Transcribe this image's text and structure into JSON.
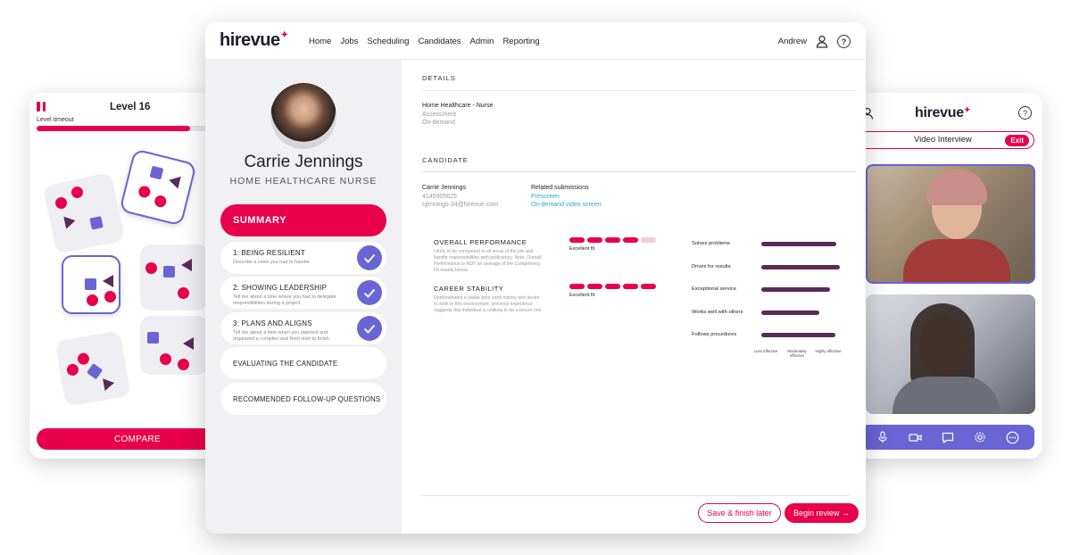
{
  "game": {
    "level": "Level 16",
    "timeout_label": "Level timeout",
    "timeout_progress": 0.78,
    "compare_button": "COMPARE"
  },
  "video": {
    "brand": "hirevue",
    "title": "Video Interview",
    "exit_label": "Exit",
    "help_symbol": "?",
    "toolbar_icons": [
      "microphone-icon",
      "camera-icon",
      "chat-icon",
      "settings-icon",
      "more-icon"
    ]
  },
  "main": {
    "brand": "hirevue",
    "nav": [
      "Home",
      "Jobs",
      "Scheduling",
      "Candidates",
      "Admin",
      "Reporting"
    ],
    "user": "Andrew",
    "help_symbol": "?",
    "candidate": {
      "name": "Carrie Jennings",
      "role": "HOME HEALTHCARE NURSE"
    },
    "summary_label": "SUMMARY",
    "competencies": [
      {
        "title": "1: BEING RESILIENT",
        "desc": "Describe a crisis you had to handle.",
        "done": true
      },
      {
        "title": "2: SHOWING LEADERSHIP",
        "desc": "Tell me about a time where you had to delegate responsibilities during a project.",
        "done": true
      },
      {
        "title": "3: PLANS AND ALIGNS",
        "desc": "Tell me about a time when you planned and organized a complex task from start to finish.",
        "done": true
      },
      {
        "title": "EVALUATING THE CANDIDATE",
        "desc": "",
        "done": false
      },
      {
        "title": "RECOMMENDED FOLLOW-UP QUESTIONS",
        "desc": "",
        "done": false
      }
    ],
    "details": {
      "heading": "DETAILS",
      "job": "Home Healthcare - Nurse",
      "type": "Assessment",
      "mode": "On-demand"
    },
    "candidate_section": {
      "heading": "CANDIDATE",
      "name": "Carrie Jennings",
      "phone": "4145905625",
      "email": "cjennings-34@hirevue.com",
      "related_heading": "Related submissions",
      "related": [
        "Prescreen",
        "On-demand video screen"
      ]
    },
    "performance": {
      "overall": {
        "title": "OVERALL PERFORMANCE",
        "desc": "Likely to be competent in all areas of the job and handle responsibilities with proficiency. Note: Overall Performance is NOT an average of the Competency Fit results below.",
        "fit": "Excellent fit",
        "level": 4,
        "of": 5
      },
      "stability": {
        "title": "CAREER STABILITY",
        "desc": "Demonstrates a stable prior work history and desire to work in this environment; previous experience suggests this individual is unlikely to be a tenure risk.",
        "fit": "Excellent fit",
        "level": 5,
        "of": 5
      },
      "traits": [
        {
          "label": "Solves problems",
          "value": 0.88
        },
        {
          "label": "Drives for results",
          "value": 0.92
        },
        {
          "label": "Exceptional service",
          "value": 0.8
        },
        {
          "label": "Works well with others",
          "value": 0.68
        },
        {
          "label": "Follows procedures",
          "value": 0.86
        }
      ],
      "scale": [
        "Less effective",
        "Moderately effective",
        "Highly effective"
      ]
    },
    "buttons": {
      "save": "Save & finish later",
      "begin": "Begin review →"
    }
  }
}
